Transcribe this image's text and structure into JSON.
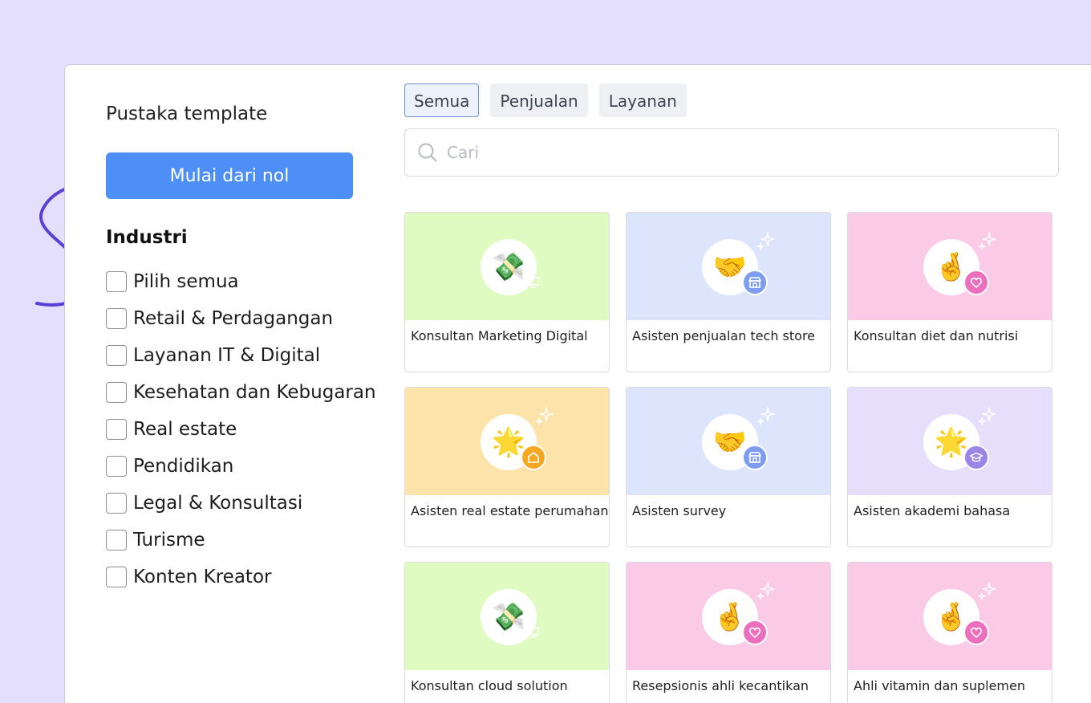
{
  "sidebar": {
    "title": "Pustaka template",
    "start_button": "Mulai dari nol",
    "industry_heading": "Industri",
    "filters": [
      "Pilih semua",
      "Retail & Perdagangan",
      "Layanan IT & Digital",
      "Kesehatan dan Kebugaran",
      "Real estate",
      "Pendidikan",
      "Legal & Konsultasi",
      "Turisme",
      "Konten Kreator"
    ]
  },
  "tabs": [
    "Semua",
    "Penjualan",
    "Layanan"
  ],
  "active_tab": "Semua",
  "search": {
    "placeholder": "Cari"
  },
  "templates": [
    {
      "title": "Konsultan Marketing Digital",
      "emoji": "💸",
      "badge_icon": "monitor-icon",
      "bg": "#dffbc1",
      "badge_color": null,
      "sparkle": false
    },
    {
      "title": "Asisten penjualan tech store",
      "emoji": "🤝",
      "badge_icon": "store-icon",
      "bg": "#dde5fd",
      "badge_color": "#7e9df1",
      "sparkle": true
    },
    {
      "title": "Konsultan diet dan nutrisi",
      "emoji": "🤞",
      "badge_icon": "heart-icon",
      "bg": "#fbcae6",
      "badge_color": "#ec6fbd",
      "sparkle": true
    },
    {
      "title": "Asisten real estate perumahan",
      "emoji": "🌟",
      "badge_icon": "home-icon",
      "bg": "#fce3a9",
      "badge_color": "#f7a823",
      "sparkle": true
    },
    {
      "title": "Asisten survey",
      "emoji": "🤝",
      "badge_icon": "store-icon",
      "bg": "#dde5fd",
      "badge_color": "#7e9df1",
      "sparkle": true
    },
    {
      "title": "Asisten akademi bahasa",
      "emoji": "🌟",
      "badge_icon": "graduation-cap-icon",
      "bg": "#e5dffc",
      "badge_color": "#9a85e6",
      "sparkle": true
    },
    {
      "title": "Konsultan cloud solution",
      "emoji": "💸",
      "badge_icon": "monitor-icon",
      "bg": "#dffbc1",
      "badge_color": null,
      "sparkle": false
    },
    {
      "title": "Resepsionis ahli kecantikan",
      "emoji": "🤞",
      "badge_icon": "heart-icon",
      "bg": "#fbcae6",
      "badge_color": "#ec6fbd",
      "sparkle": true
    },
    {
      "title": "Ahli vitamin dan suplemen",
      "emoji": "🤞",
      "badge_icon": "heart-icon",
      "bg": "#fbcae6",
      "badge_color": "#ec6fbd",
      "sparkle": true
    }
  ],
  "colors": {
    "page_background": "#e4dffd",
    "accent": "#4e8ef7",
    "swirl": "#5a3fd6"
  }
}
